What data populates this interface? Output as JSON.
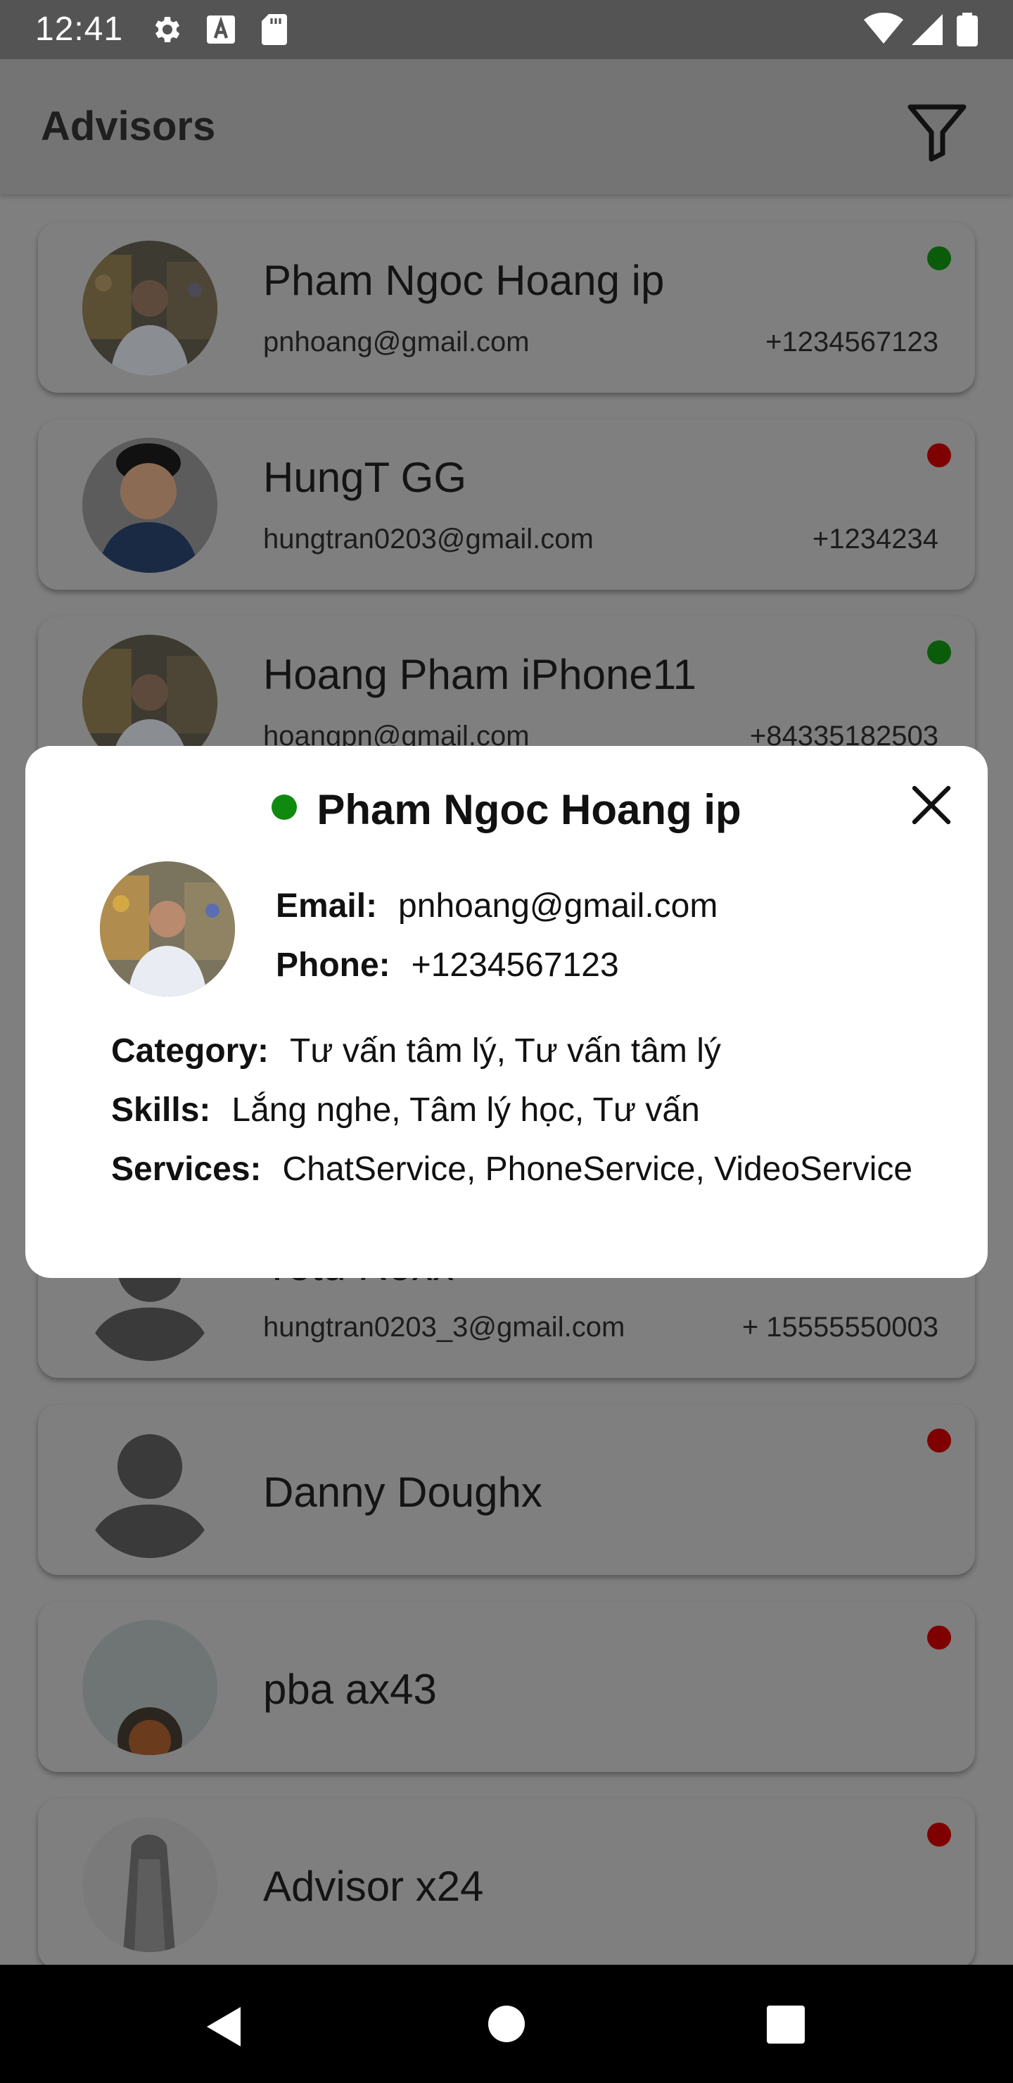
{
  "status_bar": {
    "time": "12:41"
  },
  "app_bar": {
    "title": "Advisors"
  },
  "advisors": [
    {
      "name": "Pham Ngoc Hoang ip",
      "email": "pnhoang@gmail.com",
      "phone": "+1234567123",
      "status": "online"
    },
    {
      "name": "HungT GG",
      "email": "hungtran0203@gmail.com",
      "phone": "+1234234",
      "status": "offline"
    },
    {
      "name": "Hoang Pham iPhone11",
      "email": "hoangpn@gmail.com",
      "phone": "+84335182503",
      "status": "online"
    },
    {
      "name": "Yetu Roxx",
      "email": "hungtran0203_3@gmail.com",
      "phone": "+ 15555550003",
      "status": ""
    },
    {
      "name": "Danny Doughx",
      "email": "",
      "phone": "",
      "status": "offline"
    },
    {
      "name": "pba ax43",
      "email": "",
      "phone": "",
      "status": "offline"
    },
    {
      "name": "Advisor x24",
      "email": "",
      "phone": "",
      "status": "offline"
    }
  ],
  "dialog": {
    "name": "Pham Ngoc Hoang ip",
    "email_label": "Email:",
    "email": "pnhoang@gmail.com",
    "phone_label": "Phone:",
    "phone": "+1234567123",
    "category_label": "Category:",
    "category": "Tư vấn tâm lý, Tư vấn tâm lý",
    "skills_label": "Skills:",
    "skills": "Lắng nghe, Tâm lý học, Tư vấn",
    "services_label": "Services:",
    "services": "ChatService, PhoneService, VideoService"
  },
  "colors": {
    "online": "#0f8a0f",
    "offline": "#e00000",
    "scrim": "#7f7f7f"
  },
  "icons": [
    "settings-icon",
    "font-icon",
    "sd-card-icon",
    "wifi-icon",
    "signal-icon",
    "battery-icon",
    "filter-icon",
    "close-icon",
    "back-icon",
    "home-icon",
    "recents-icon"
  ]
}
